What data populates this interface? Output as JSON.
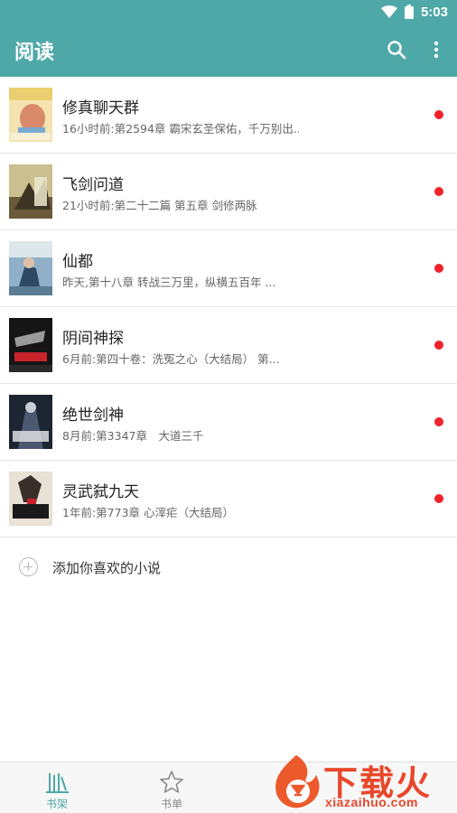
{
  "status_bar": {
    "time": "5:03",
    "icons": [
      "wifi-icon",
      "battery-icon"
    ]
  },
  "app_bar": {
    "title": "阅读",
    "actions": [
      "search-icon",
      "more-vert-icon"
    ]
  },
  "colors": {
    "primary": "#4fa8a8",
    "unread_dot": "#f0222a",
    "watermark": "#e8472b"
  },
  "books": [
    {
      "title": "修真聊天群",
      "subtitle": "16小时前:第2594章 霸宋玄圣保佑，千万别出..."
    },
    {
      "title": "飞剑问道",
      "subtitle": "21小时前:第二十二篇 第五章 剑修两脉"
    },
    {
      "title": "仙都",
      "subtitle": "昨天,第十八章 转战三万里，纵横五百年 ..."
    },
    {
      "title": "阴间神探",
      "subtitle": "6月前:第四十卷：洗冤之心（大结局） 第..."
    },
    {
      "title": "绝世剑神",
      "subtitle": "8月前:第3347章　大道三千"
    },
    {
      "title": "灵武弑九天",
      "subtitle": "1年前:第773章 心滓疟（大结局）"
    }
  ],
  "add_book": {
    "label": "添加你喜欢的小说"
  },
  "bottom_nav": [
    {
      "label": "书架",
      "icon": "bookshelf-icon",
      "active": true
    },
    {
      "label": "书单",
      "icon": "star-icon",
      "active": false
    }
  ],
  "watermark": {
    "text": "下载火",
    "url": "xiazaihuo.com"
  }
}
